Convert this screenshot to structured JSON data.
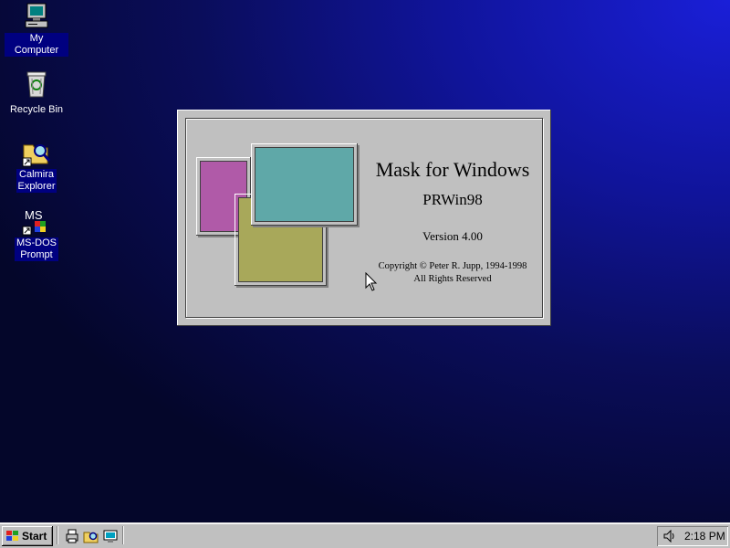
{
  "desktop": {
    "icons": [
      {
        "label": "My Computer"
      },
      {
        "label": "Recycle Bin"
      },
      {
        "label": "Calmira\nExplorer"
      },
      {
        "label": "MS-DOS\nPrompt"
      }
    ]
  },
  "splash": {
    "title": "Mask for Windows",
    "subtitle": "PRWin98",
    "version": "Version 4.00",
    "copyright": "Copyright © Peter R. Jupp, 1994-1998",
    "rights": "All Rights Reserved",
    "colors": {
      "magenta": "#b05aa8",
      "teal": "#5fa8a8",
      "olive": "#a8a85a"
    }
  },
  "taskbar": {
    "start_label": "Start",
    "clock": "2:18 PM"
  },
  "icons": {
    "start": "windows-flag-icon",
    "quicklaunch": [
      "printer-icon",
      "folder-search-icon",
      "desktop-icon"
    ],
    "tray": "speaker-icon"
  }
}
